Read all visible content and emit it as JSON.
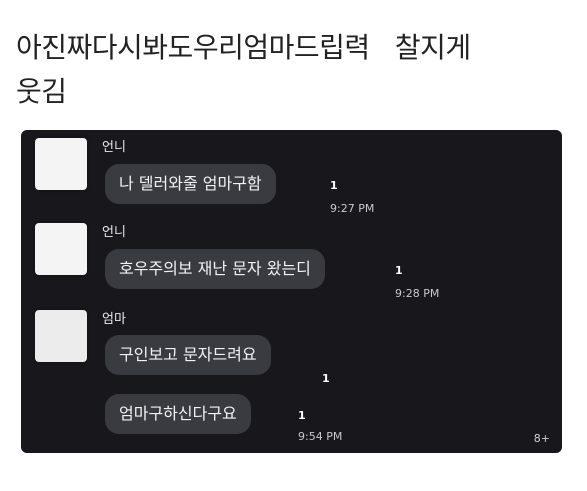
{
  "post": {
    "text": "아진짜다시봐도우리엄마드립력   찰지게\n웃김"
  },
  "chat": {
    "messages": [
      {
        "sender": "언니",
        "text": "나 델러와줄 엄마구함",
        "unread": "1",
        "time": "9:27 PM"
      },
      {
        "sender": "언니",
        "text": "호우주의보 재난 문자 왔는디",
        "unread": "1",
        "time": "9:28 PM"
      },
      {
        "sender": "엄마",
        "text": "구인보고 문자드려요",
        "unread": "1",
        "time": ""
      },
      {
        "sender": "",
        "text": "엄마구하신다구요",
        "unread": "1",
        "time": "9:54 PM"
      }
    ],
    "user_count": "8+"
  }
}
